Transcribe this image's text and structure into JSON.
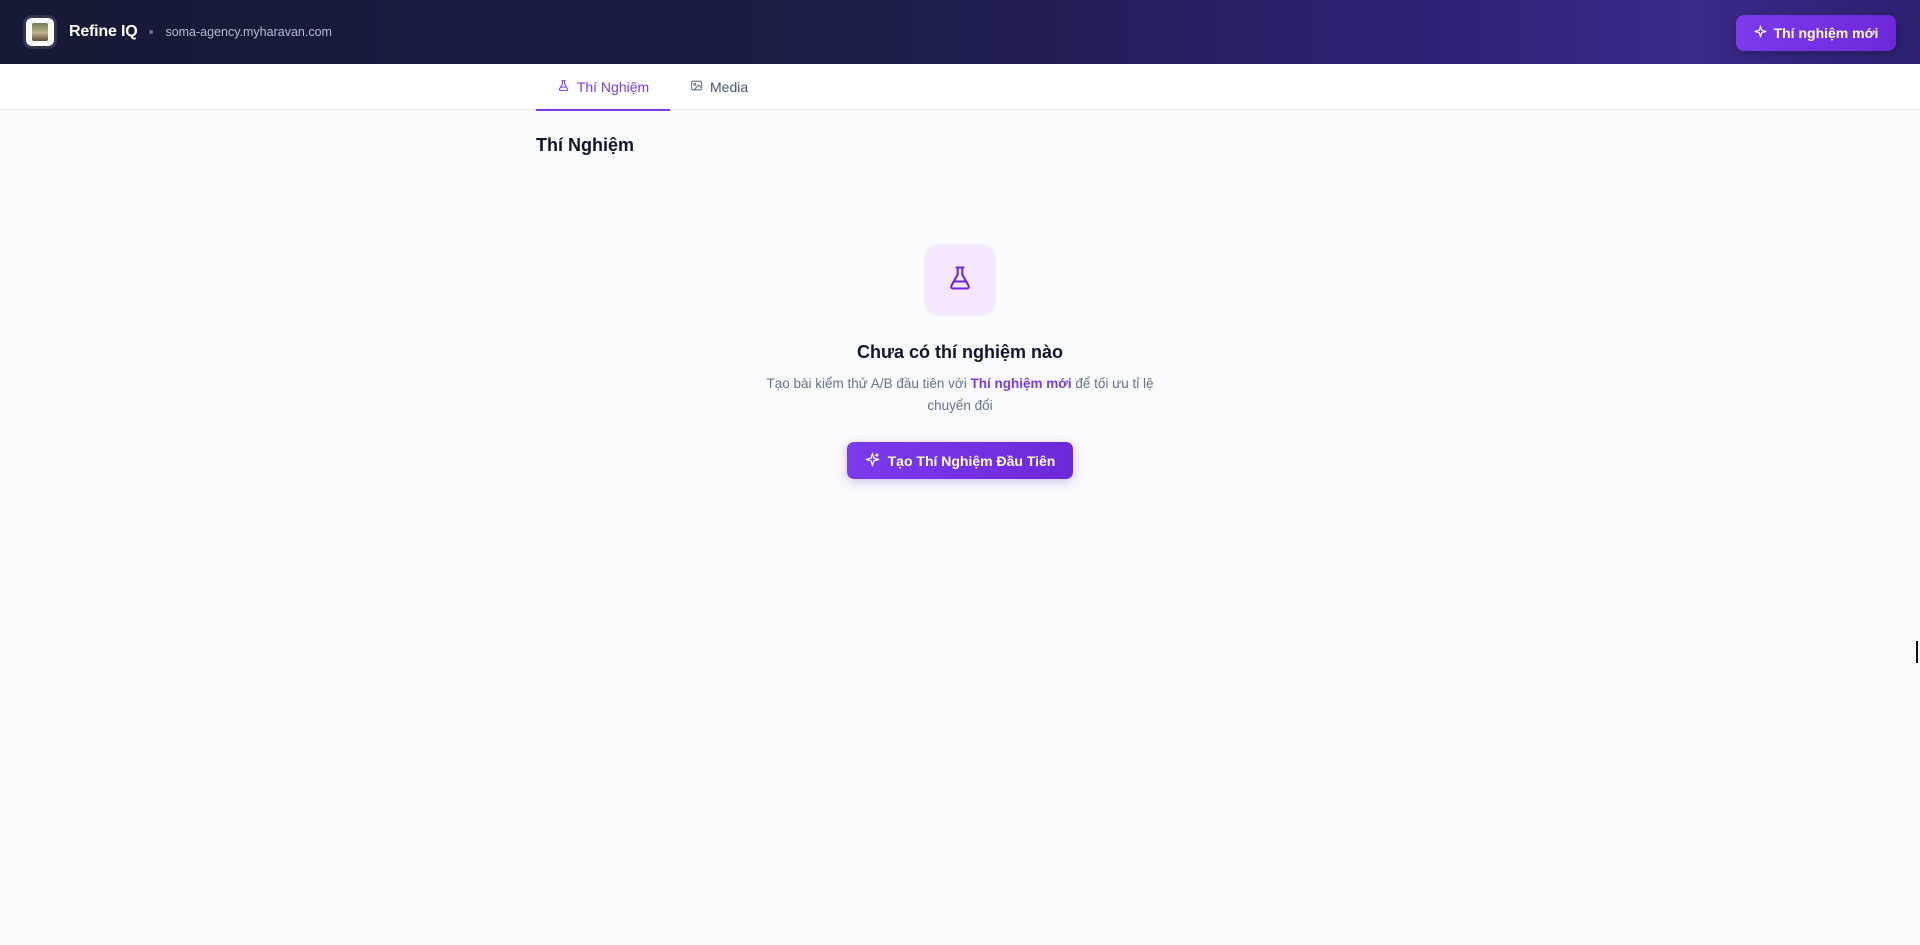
{
  "header": {
    "app_name": "Refine IQ",
    "store_domain": "soma-agency.myharavan.com",
    "new_experiment_label": "Thí nghiệm mới"
  },
  "tabs": [
    {
      "label": "Thí Nghiệm",
      "icon": "flask-icon",
      "active": true
    },
    {
      "label": "Media",
      "icon": "image-icon",
      "active": false
    }
  ],
  "main": {
    "page_title": "Thí Nghiệm",
    "empty_state": {
      "icon": "flask-icon",
      "title": "Chưa có thí nghiệm nào",
      "desc_before": "Tạo bài kiểm thử A/B đầu tiên với ",
      "desc_highlight": "Thí nghiệm mới",
      "desc_after": " để tối ưu tỉ lệ chuyển đổi",
      "cta_label": "Tạo Thí Nghiệm Đầu Tiên"
    }
  },
  "colors": {
    "accent": "#7c3aed",
    "header_bg": "#1c1d47",
    "icon_box_bg": "#f3e8ff",
    "page_bg": "#f8fafc"
  }
}
